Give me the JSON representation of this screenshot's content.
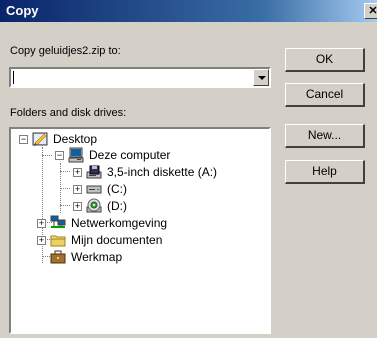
{
  "window": {
    "title": "Copy",
    "close_label": "✕"
  },
  "copy_to": {
    "label": "Copy geluidjes2.zip to:",
    "value": ""
  },
  "folders": {
    "label": "Folders and disk drives:",
    "items": [
      {
        "label": "Desktop",
        "icon": "desktop-icon",
        "expander": "−"
      },
      {
        "label": "Deze computer",
        "icon": "computer-icon",
        "expander": "−"
      },
      {
        "label": "3,5-inch diskette (A:)",
        "icon": "floppy-drive-icon",
        "expander": "+"
      },
      {
        "label": "(C:)",
        "icon": "hard-drive-icon",
        "expander": "+"
      },
      {
        "label": "(D:)",
        "icon": "cd-drive-icon",
        "expander": "+"
      },
      {
        "label": "Netwerkomgeving",
        "icon": "network-icon",
        "expander": "+"
      },
      {
        "label": "Mijn documenten",
        "icon": "folder-icon",
        "expander": "+"
      },
      {
        "label": "Werkmap",
        "icon": "briefcase-icon",
        "expander": ""
      }
    ]
  },
  "buttons": {
    "ok": "OK",
    "cancel": "Cancel",
    "new": "New...",
    "help": "Help"
  }
}
